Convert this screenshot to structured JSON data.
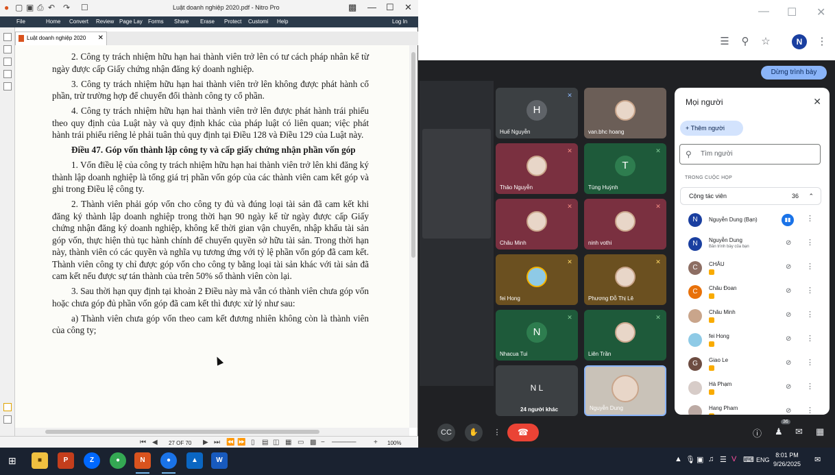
{
  "nitro": {
    "title": "Luật doanh nghiệp 2020.pdf - Nitro Pro",
    "menu": [
      "File",
      "Home",
      "Convert",
      "Review",
      "Page Lay",
      "Forms",
      "Share",
      "Erase",
      "Protect",
      "Customi",
      "Help"
    ],
    "login": "Log In",
    "tab_label": "Luật doanh nghiệp 2020",
    "page_indicator": "27 OF 70",
    "zoom": "100%",
    "document": {
      "p1": "2. Công ty trách nhiệm hữu hạn hai thành viên trở lên có tư cách pháp nhân kể từ ngày được cấp Giấy chứng nhận đăng ký doanh nghiệp.",
      "p2": "3. Công ty trách nhiệm hữu hạn hai thành viên trở lên không được phát hành cổ phần, trừ trường hợp để chuyển đổi thành công ty cổ phần.",
      "p3": "4. Công ty trách nhiệm hữu hạn hai thành viên trở lên được phát hành trái phiếu theo quy định của Luật này và quy định khác của pháp luật có liên quan; việc phát hành trái phiếu riêng lẻ phải tuân thủ quy định tại Điều 128 và Điều 129 của Luật này.",
      "heading": "Điều 47. Góp vốn thành lập công ty và cấp giấy chứng nhận phần vốn góp",
      "p4": "1. Vốn điều lệ của công ty trách nhiệm hữu hạn hai thành viên trở lên khi đăng ký thành lập doanh nghiệp là tổng giá trị phần vốn góp của các thành viên cam kết góp và ghi trong Điều lệ công ty.",
      "p5": "2. Thành viên phải góp vốn cho công ty đủ và đúng loại tài sản đã cam kết khi đăng ký thành lập doanh nghiệp trong thời hạn 90 ngày kể từ ngày được cấp Giấy chứng nhận đăng ký doanh nghiệp, không kể thời gian vận chuyển, nhập khẩu tài sản góp vốn, thực hiện thủ tục hành chính để chuyển quyền sở hữu tài sản. Trong thời hạn này, thành viên có các quyền và nghĩa vụ tương ứng với tỷ lệ phần vốn góp đã cam kết. Thành viên công ty chỉ được góp vốn cho công ty bằng loại tài sản khác với tài sản đã cam kết nếu được sự tán thành của trên 50% số thành viên còn lại.",
      "p6": "3. Sau thời hạn quy định tại khoản 2 Điều này mà vẫn có thành viên chưa góp vốn hoặc chưa góp đủ phần vốn góp đã cam kết thì được xử lý như sau:",
      "p7": "a) Thành viên chưa góp vốn theo cam kết đương nhiên không còn là thành viên của công ty;"
    }
  },
  "meet": {
    "stop_presenting": "Dừng trình bày",
    "tiles": [
      {
        "name": "Huế Nguyễn",
        "initial": "H"
      },
      {
        "name": "van.bhc hoang",
        "initial": ""
      },
      {
        "name": "Thảo Nguyễn",
        "initial": ""
      },
      {
        "name": "Tùng Huỳnh",
        "initial": "T"
      },
      {
        "name": "Châu Minh",
        "initial": ""
      },
      {
        "name": "ninh vothi",
        "initial": ""
      },
      {
        "name": "fei Hong",
        "initial": ""
      },
      {
        "name": "Phương Đỗ Thị Lê",
        "initial": ""
      },
      {
        "name": "Nhacua Tui",
        "initial": "N"
      },
      {
        "name": "Liên Trần",
        "initial": ""
      },
      {
        "name": "24 người khác",
        "initial": "N L"
      },
      {
        "name": "Nguyễn Dung",
        "initial": ""
      }
    ],
    "people_panel": {
      "title": "Mọi người",
      "add_people": "Thêm người",
      "search_placeholder": "Tìm người",
      "section": "TRONG CUỘC HỌP",
      "group": "Cộng tác viên",
      "group_count": "36",
      "people": [
        {
          "name": "Nguyễn Dung (Bạn)",
          "sub": "",
          "initial": "N",
          "color": "#1a3fa0"
        },
        {
          "name": "Nguyễn Dung",
          "sub": "Bản trình bày của bạn",
          "initial": "N",
          "color": "#1a3fa0"
        },
        {
          "name": "CHÂU",
          "sub": "",
          "initial": "C",
          "color": "#8d6e63"
        },
        {
          "name": "Châu Đoan",
          "sub": "",
          "initial": "C",
          "color": "#e8710a"
        },
        {
          "name": "Châu Minh",
          "sub": "",
          "initial": "",
          "color": "#c9a58b"
        },
        {
          "name": "fei Hong",
          "sub": "",
          "initial": "",
          "color": "#f4b400"
        },
        {
          "name": "Giao Le",
          "sub": "",
          "initial": "G",
          "color": "#6d4c41"
        },
        {
          "name": "Hà Phạm",
          "sub": "",
          "initial": "",
          "color": "#d7ccc8"
        },
        {
          "name": "Hang Pham",
          "sub": "",
          "initial": "",
          "color": "#bcaaa4"
        }
      ]
    },
    "participant_count": "36"
  },
  "taskbar": {
    "language": "ENG",
    "time": "8:01 PM",
    "date": "9/26/2025"
  }
}
